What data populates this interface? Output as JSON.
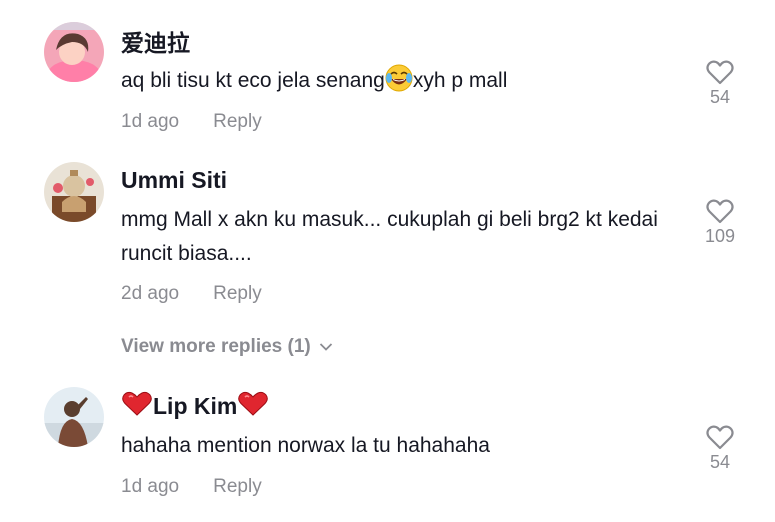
{
  "comments": [
    {
      "username": "爱迪拉",
      "text_before": "aq bli tisu kt eco jela senang",
      "emoji": "laughing-tears-emoji",
      "text_after": "xyh p mall",
      "time": "1d ago",
      "reply_label": "Reply",
      "likes": "54"
    },
    {
      "username": "Ummi Siti",
      "text": "mmg Mall x akn ku masuk... cukuplah gi beli brg2 kt kedai runcit biasa....",
      "time": "2d ago",
      "reply_label": "Reply",
      "likes": "109",
      "view_more": "View more replies (1)"
    },
    {
      "username": "Lip Kim",
      "username_emoji": "red-heart-emoji",
      "text": "hahaha mention norwax la tu hahahaha",
      "time": "1d ago",
      "reply_label": "Reply",
      "likes": "54"
    }
  ],
  "colors": {
    "primary_text": "#161823",
    "secondary_text": "#8a8b91"
  }
}
